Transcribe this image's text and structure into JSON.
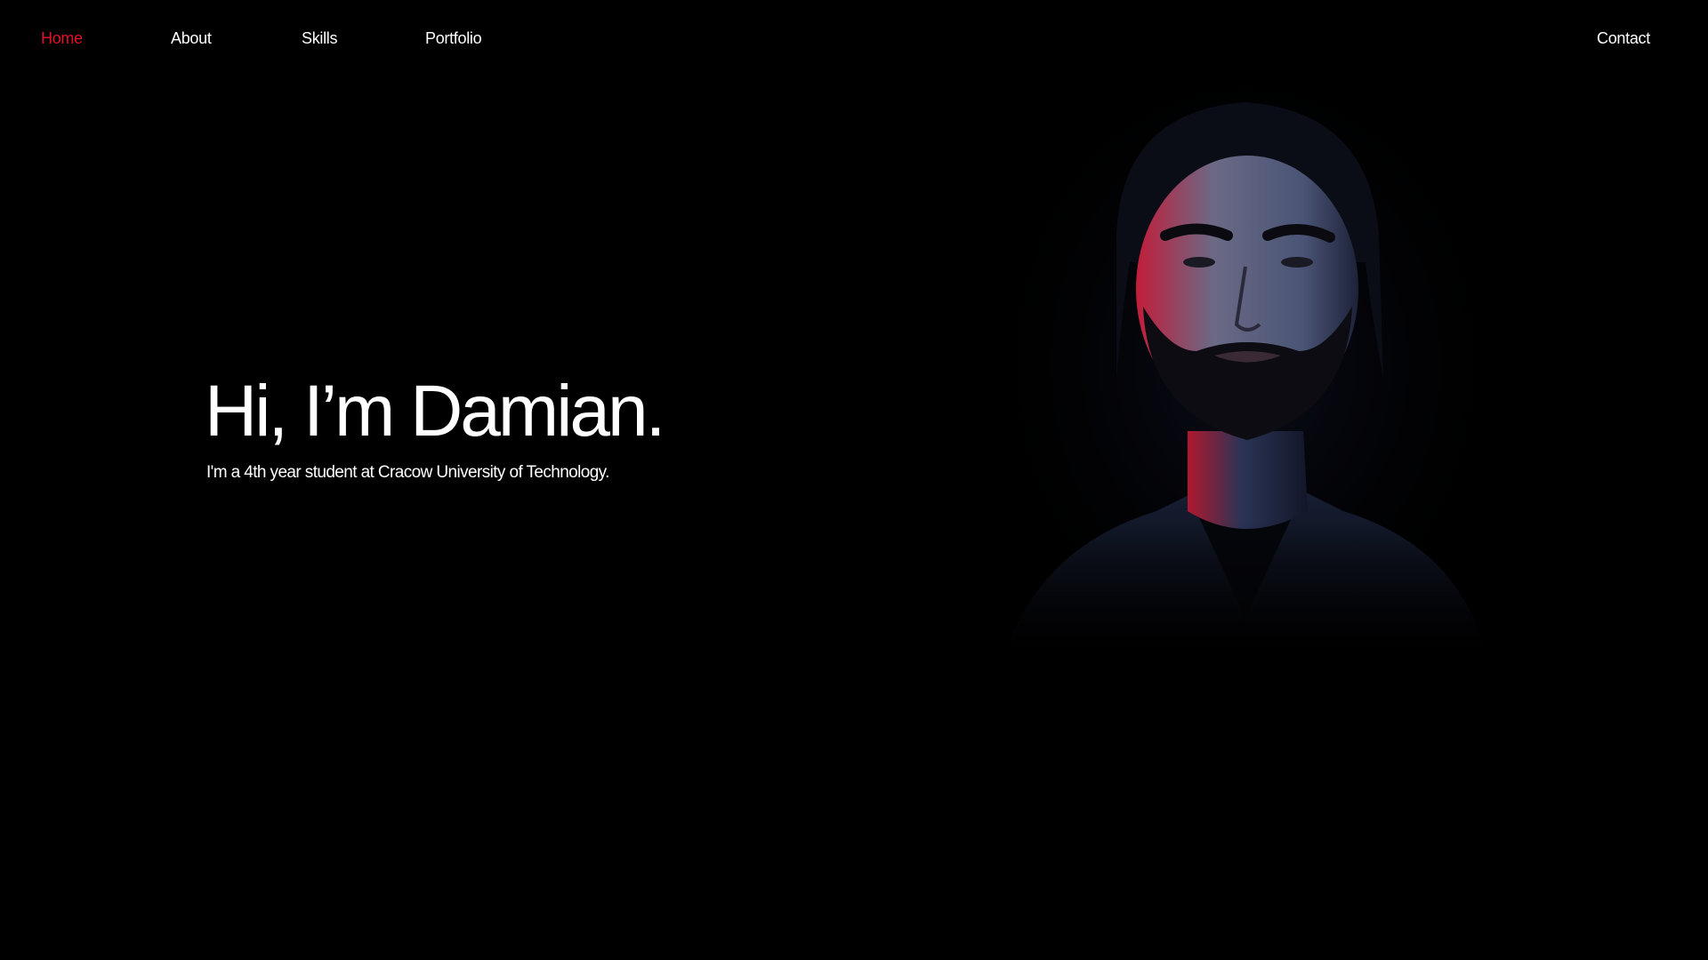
{
  "nav": {
    "home": "Home",
    "about": "About",
    "skills": "Skills",
    "portfolio": "Portfolio",
    "contact": "Contact",
    "active": "home"
  },
  "hero": {
    "title": "Hi, I’m Damian.",
    "subtitle": "I'm a 4th year student at Cracow University of Technology."
  },
  "colors": {
    "background": "#000000",
    "text": "#ffffff",
    "accent": "#e0102b"
  },
  "portrait": {
    "icon": "person-photo"
  }
}
